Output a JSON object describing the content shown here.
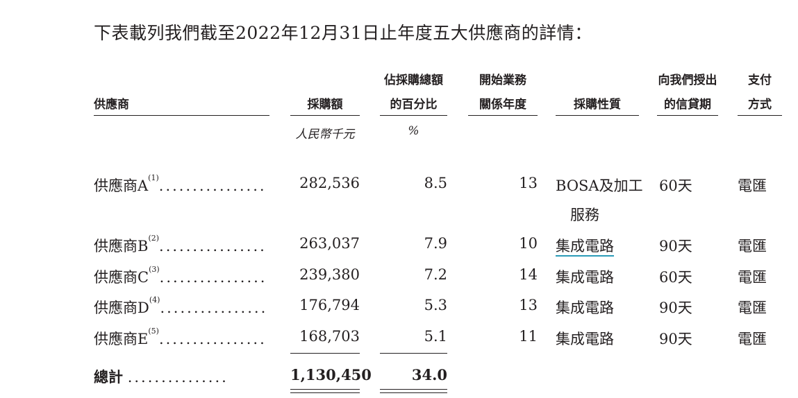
{
  "intro": "下表載列我們截至2022年12月31日止年度五大供應商的詳情：",
  "headers": {
    "supplier": "供應商",
    "amount": "採購額",
    "pct_line1": "佔採購總額",
    "pct_line2": "的百分比",
    "years_line1": "開始業務",
    "years_line2": "關係年度",
    "nature": "採購性質",
    "credit_line1": "向我們授出",
    "credit_line2": "的信貸期",
    "pay_line1": "支付",
    "pay_line2": "方式"
  },
  "units": {
    "amount": "人民幣千元",
    "pct": "%"
  },
  "rows": [
    {
      "name": "供應商A",
      "note": "(1)",
      "dots": "................",
      "amount": "282,536",
      "pct": "8.5",
      "years": "13",
      "nature_line1": "BOSA及加工",
      "nature_line2": "服務",
      "credit": "60天",
      "payment": "電匯"
    },
    {
      "name": "供應商B",
      "note": "(2)",
      "dots": "................",
      "amount": "263,037",
      "pct": "7.9",
      "years": "10",
      "nature_line1": "集成電路",
      "credit": "90天",
      "payment": "電匯"
    },
    {
      "name": "供應商C",
      "note": "(3)",
      "dots": "................",
      "amount": "239,380",
      "pct": "7.2",
      "years": "14",
      "nature_line1": "集成電路",
      "credit": "60天",
      "payment": "電匯"
    },
    {
      "name": "供應商D",
      "note": "(4)",
      "dots": "................",
      "amount": "176,794",
      "pct": "5.3",
      "years": "13",
      "nature_line1": "集成電路",
      "credit": "90天",
      "payment": "電匯"
    },
    {
      "name": "供應商E",
      "note": "(5)",
      "dots": "................",
      "amount": "168,703",
      "pct": "5.1",
      "years": "11",
      "nature_line1": "集成電路",
      "credit": "90天",
      "payment": "電匯"
    }
  ],
  "total": {
    "label": "總計",
    "dots": "...............",
    "amount": "1,130,450",
    "pct": "34.0"
  }
}
